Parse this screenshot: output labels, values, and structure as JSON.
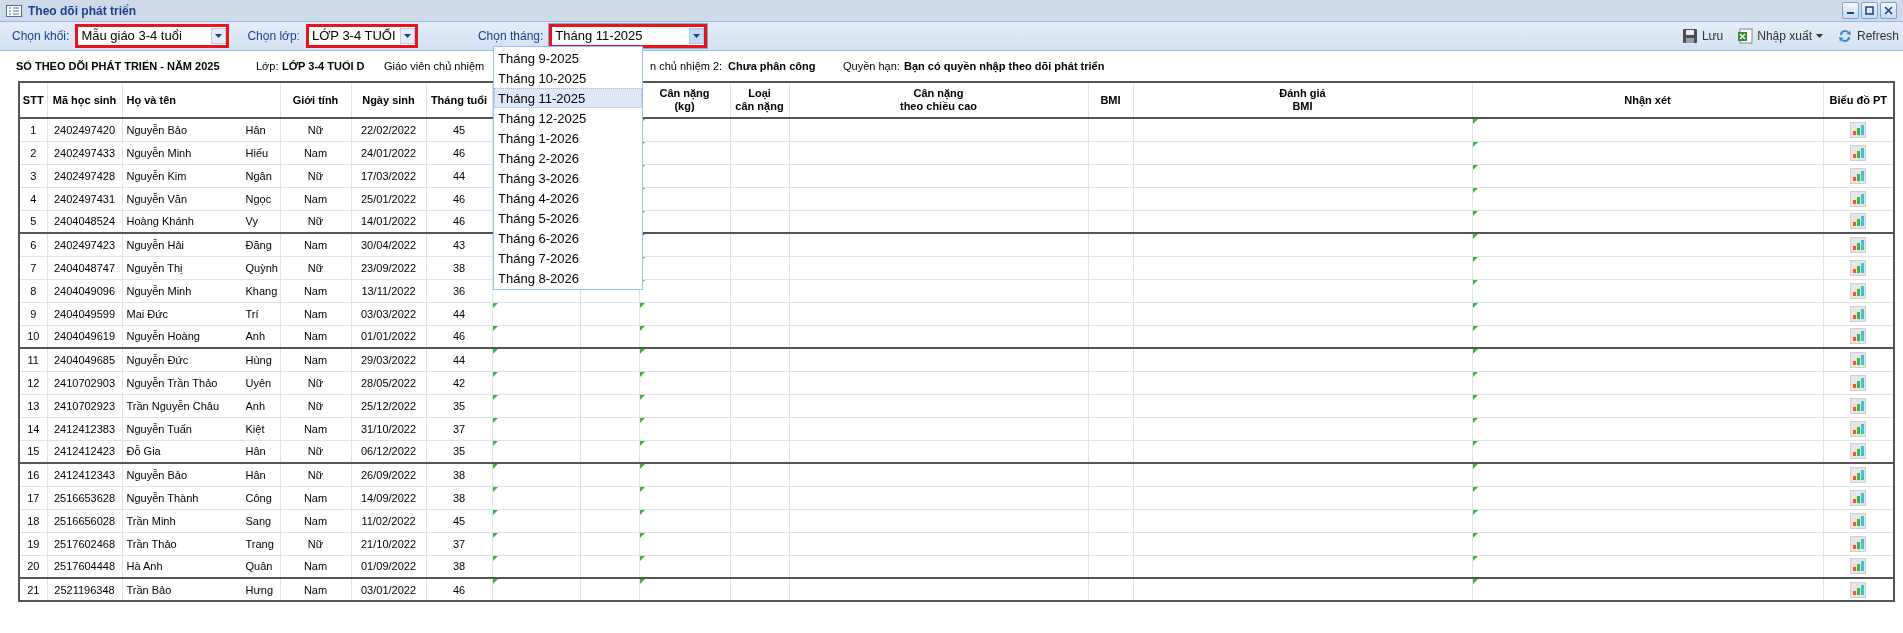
{
  "window": {
    "title": "Theo dõi phát triển"
  },
  "toolbar": {
    "filters": [
      {
        "label": "Chọn khối:",
        "value": "Mẫu giáo 3-4 tuổi",
        "highlighted": true,
        "expanded": false
      },
      {
        "label": "Chọn lớp:",
        "value": "LỚP 3-4 TUỔI",
        "highlighted": true,
        "expanded": false
      },
      {
        "label": "Chọn tháng:",
        "value": "Tháng 11-2025",
        "highlighted": true,
        "expanded": true
      }
    ],
    "buttons": [
      {
        "kind": "save",
        "label": "Lưu"
      },
      {
        "kind": "export",
        "label": "Nhập xuất"
      },
      {
        "kind": "refresh",
        "label": "Refresh"
      }
    ]
  },
  "month_options": [
    {
      "label": "Tháng 9-2025",
      "selected": false
    },
    {
      "label": "Tháng 10-2025",
      "selected": false
    },
    {
      "label": "Tháng 11-2025",
      "selected": true
    },
    {
      "label": "Tháng 12-2025",
      "selected": false
    },
    {
      "label": "Tháng 1-2026",
      "selected": false
    },
    {
      "label": "Tháng 2-2026",
      "selected": false
    },
    {
      "label": "Tháng 3-2026",
      "selected": false
    },
    {
      "label": "Tháng 4-2026",
      "selected": false
    },
    {
      "label": "Tháng 5-2026",
      "selected": false
    },
    {
      "label": "Tháng 6-2026",
      "selected": false
    },
    {
      "label": "Tháng 7-2026",
      "selected": false
    },
    {
      "label": "Tháng 8-2026",
      "selected": false
    }
  ],
  "info": {
    "title": "SỔ THEO DÕI PHÁT TRIỂN - NĂM 2025",
    "class_label": "Lớp:",
    "class_value": "LỚP 3-4 TUỔI D",
    "teacher_label": "Giáo viên chủ nhiệm",
    "teacher2_label": "n chủ nhiệm 2:",
    "teacher2_value": "Chưa phân công",
    "rights_label": "Quyền hạn:",
    "rights_value": "Bạn có quyền nhập theo dõi phát triển"
  },
  "table": {
    "columns": [
      "STT",
      "Mã học sinh",
      "Họ và tên",
      "Giới tính",
      "Ngày sinh",
      "Tháng tuổi",
      "Cân nặng\n(kg)",
      "Loại\ncân nặng",
      "Cân nặng\ntheo chiều cao",
      "BMI",
      "Đánh giá\nBMI",
      "Nhận xét",
      "Biểu đồ PT"
    ],
    "rows": [
      [
        "1",
        "2402497420",
        [
          "Nguyễn Bảo",
          "Hân"
        ],
        "Nữ",
        "22/02/2022",
        "45"
      ],
      [
        "2",
        "2402497433",
        [
          "Nguyễn Minh",
          "Hiếu"
        ],
        "Nam",
        "24/01/2022",
        "46"
      ],
      [
        "3",
        "2402497428",
        [
          "Nguyễn Kim",
          "Ngân"
        ],
        "Nữ",
        "17/03/2022",
        "44"
      ],
      [
        "4",
        "2402497431",
        [
          "Nguyễn Văn",
          "Ngọc"
        ],
        "Nam",
        "25/01/2022",
        "46"
      ],
      [
        "5",
        "2404048524",
        [
          "Hoàng Khánh",
          "Vy"
        ],
        "Nữ",
        "14/01/2022",
        "46"
      ],
      [
        "6",
        "2402497423",
        [
          "Nguyễn Hải",
          "Đăng"
        ],
        "Nam",
        "30/04/2022",
        "43"
      ],
      [
        "7",
        "2404048747",
        [
          "Nguyễn Thị",
          "Quỳnh"
        ],
        "Nữ",
        "23/09/2022",
        "38"
      ],
      [
        "8",
        "2404049096",
        [
          "Nguyễn Minh",
          "Khang"
        ],
        "Nam",
        "13/11/2022",
        "36"
      ],
      [
        "9",
        "2404049599",
        [
          "Mai Đức",
          "Trí"
        ],
        "Nam",
        "03/03/2022",
        "44"
      ],
      [
        "10",
        "2404049619",
        [
          "Nguyễn Hoàng",
          "Anh"
        ],
        "Nam",
        "01/01/2022",
        "46"
      ],
      [
        "11",
        "2404049685",
        [
          "Nguyễn Đức",
          "Hùng"
        ],
        "Nam",
        "29/03/2022",
        "44"
      ],
      [
        "12",
        "2410702903",
        [
          "Nguyễn Trần Thảo",
          "Uyên"
        ],
        "Nữ",
        "28/05/2022",
        "42"
      ],
      [
        "13",
        "2410702923",
        [
          "Trần Nguyễn Châu",
          "Anh"
        ],
        "Nữ",
        "25/12/2022",
        "35"
      ],
      [
        "14",
        "2412412383",
        [
          "Nguyễn Tuấn",
          "Kiệt"
        ],
        "Nam",
        "31/10/2022",
        "37"
      ],
      [
        "15",
        "2412412423",
        [
          "Đỗ Gia",
          "Hân"
        ],
        "Nữ",
        "06/12/2022",
        "35"
      ],
      [
        "16",
        "2412412343",
        [
          "Nguyễn Bảo",
          "Hân"
        ],
        "Nữ",
        "26/09/2022",
        "38"
      ],
      [
        "17",
        "2516653628",
        [
          "Nguyễn Thành",
          "Công"
        ],
        "Nam",
        "14/09/2022",
        "38"
      ],
      [
        "18",
        "2516656028",
        [
          "Trần Minh",
          "Sang"
        ],
        "Nam",
        "11/02/2022",
        "45"
      ],
      [
        "19",
        "2517602468",
        [
          "Trần Thảo",
          "Trang"
        ],
        "Nữ",
        "21/10/2022",
        "37"
      ],
      [
        "20",
        "2517604448",
        [
          "Hà Anh",
          "Quân"
        ],
        "Nam",
        "01/09/2022",
        "38"
      ],
      [
        "21",
        "2521196348",
        [
          "Trần Bảo",
          "Hưng"
        ],
        "Nam",
        "03/01/2022",
        "46"
      ]
    ]
  }
}
